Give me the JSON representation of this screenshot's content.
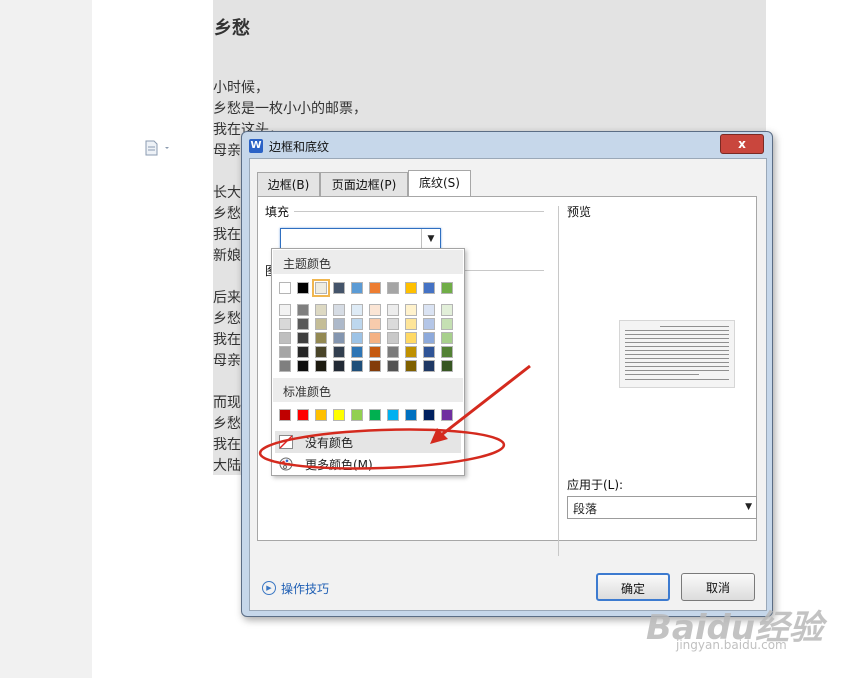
{
  "document": {
    "title": "乡愁",
    "lines": [
      "小时候，",
      "乡愁是一枚小小的邮票，",
      "我在这头，",
      "母亲",
      "长大",
      "乡愁",
      "我在",
      "新娘",
      "后来",
      "乡愁",
      "我在",
      "母亲",
      "而现",
      "乡愁",
      "我在",
      "大陆"
    ]
  },
  "dialog": {
    "title": "边框和底纹",
    "app_icon": "W",
    "close_label": "x",
    "tabs": [
      {
        "label": "边框(B)",
        "active": false
      },
      {
        "label": "页面边框(P)",
        "active": false
      },
      {
        "label": "底纹(S)",
        "active": true
      }
    ],
    "fill": {
      "label": "填充",
      "value": ""
    },
    "pattern_label": "图",
    "preview_label": "预览",
    "apply_to": {
      "label": "应用于(L):",
      "value": "段落"
    },
    "tips_link": "操作技巧",
    "ok_button": "确定",
    "cancel_button": "取消"
  },
  "color_popup": {
    "theme_label": "主题颜色",
    "theme_top_row": [
      "#ffffff",
      "#000000",
      "#eeece1",
      "#44546a",
      "#5b9bd5",
      "#ed7d31",
      "#a5a5a5",
      "#ffc000",
      "#4472c4",
      "#70ad47"
    ],
    "theme_shades": [
      [
        "#f2f2f2",
        "#7f7f7f",
        "#ddd9c3",
        "#d6dce4",
        "#deebf6",
        "#fbe5d5",
        "#ededed",
        "#fff2cc",
        "#dae3f3",
        "#e2efd9"
      ],
      [
        "#d8d8d8",
        "#595959",
        "#c4bd97",
        "#adb9ca",
        "#bdd7ee",
        "#f7cbac",
        "#dbdbdb",
        "#fee599",
        "#b4c6e7",
        "#c5e0b3"
      ],
      [
        "#bfbfbf",
        "#3f3f3f",
        "#938953",
        "#8496b0",
        "#9dc3e6",
        "#f4b183",
        "#c9c9c9",
        "#ffd965",
        "#8eaadb",
        "#a8d08d"
      ],
      [
        "#a5a5a5",
        "#262626",
        "#494429",
        "#323f4f",
        "#2e75b5",
        "#c55a11",
        "#7b7b7b",
        "#bf9000",
        "#2f5496",
        "#538135"
      ],
      [
        "#7f7f7f",
        "#0c0c0c",
        "#1d1b10",
        "#222a35",
        "#1e4e79",
        "#833c0b",
        "#525252",
        "#7f6000",
        "#1f3864",
        "#375623"
      ]
    ],
    "selected_theme_color": "#eeece1",
    "standard_label": "标准颜色",
    "standard_colors": [
      "#c00000",
      "#ff0000",
      "#ffc000",
      "#ffff00",
      "#92d050",
      "#00b050",
      "#00b0f0",
      "#0070c0",
      "#002060",
      "#7030a0"
    ],
    "no_color_label": "没有颜色",
    "more_colors_label": "更多颜色(M)..."
  },
  "annotation": {
    "color": "#d42a1e"
  },
  "watermark": {
    "text": "Baidu经验",
    "sub": "jingyan.baidu.com"
  }
}
